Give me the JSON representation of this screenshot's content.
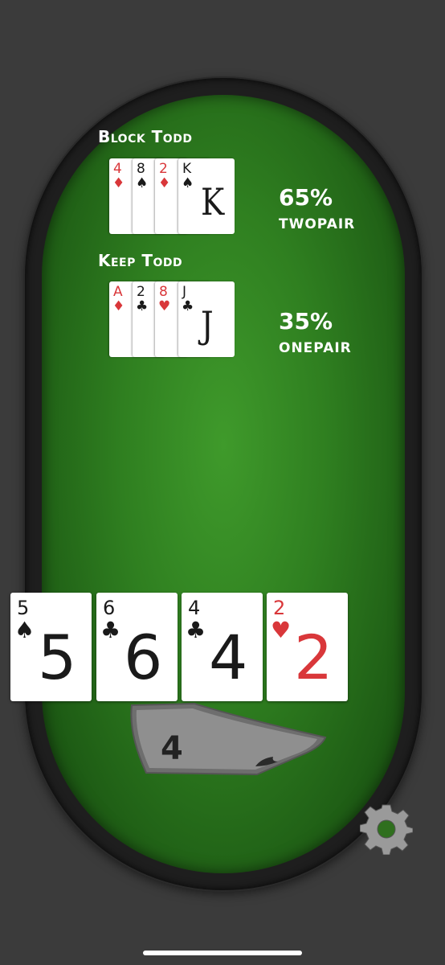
{
  "block_hand": {
    "title": "Block Todd",
    "cards": [
      {
        "rank": "4",
        "suit": "♦",
        "color": "red"
      },
      {
        "rank": "8",
        "suit": "♠",
        "color": "black"
      },
      {
        "rank": "2",
        "suit": "♦",
        "color": "red"
      },
      {
        "rank": "K",
        "suit": "♠",
        "color": "black"
      }
    ],
    "odds": "65%",
    "hand_rank": "twopair"
  },
  "keep_hand": {
    "title": "Keep Todd",
    "cards": [
      {
        "rank": "A",
        "suit": "♦",
        "color": "red"
      },
      {
        "rank": "2",
        "suit": "♣",
        "color": "black"
      },
      {
        "rank": "8",
        "suit": "♥",
        "color": "red"
      },
      {
        "rank": "J",
        "suit": "♣",
        "color": "black"
      }
    ],
    "odds": "35%",
    "hand_rank": "onepair"
  },
  "player_cards": [
    {
      "rank": "5",
      "suit": "♠",
      "color": "black"
    },
    {
      "rank": "6",
      "suit": "♣",
      "color": "black"
    },
    {
      "rank": "4",
      "suit": "♣",
      "color": "black"
    },
    {
      "rank": "2",
      "suit": "♥",
      "color": "red"
    }
  ],
  "deck": {
    "count": "4"
  },
  "colors": {
    "felt": "#2f7f20",
    "red_suit": "#d9373a",
    "rail": "#1e1e1e",
    "background": "#3b3b3b"
  },
  "icons": {
    "settings": "gear-icon",
    "deck": "card-deck-icon"
  }
}
